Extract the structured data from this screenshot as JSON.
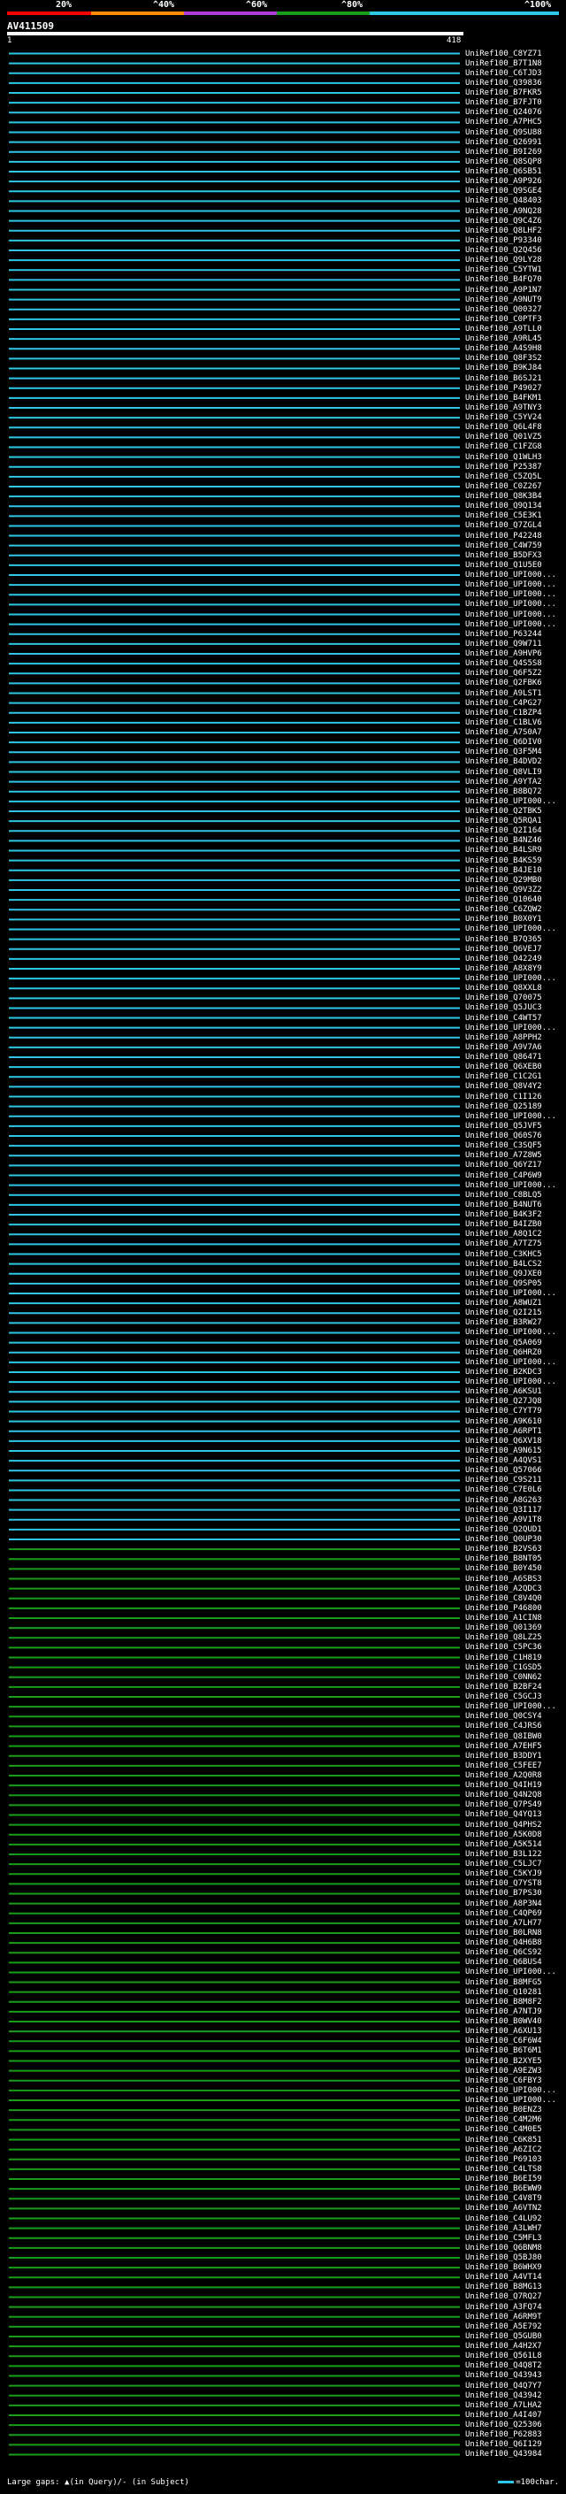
{
  "scale": {
    "labels": [
      "20%",
      "^40%",
      "^60%",
      "^80%",
      "^100%"
    ],
    "colors": [
      "#ff0000",
      "#ff8c00",
      "#b23ad6",
      "#1a9e1a",
      "#2ec8e6"
    ]
  },
  "query": {
    "title": "AV411509",
    "start": "1",
    "end": "418"
  },
  "colors": {
    "blue": "#2ec8e6",
    "green": "#1a9e1a",
    "gap": "#000000"
  },
  "hits": [
    "UniRef100_C8YZ71",
    "UniRef100_B7T1N8",
    "UniRef100_C6TJD3",
    "UniRef100_Q39836",
    "UniRef100_B7FKR5",
    "UniRef100_B7FJT0",
    "UniRef100_Q24076",
    "UniRef100_A7PHC5",
    "UniRef100_Q9SU88",
    "UniRef100_Q26991",
    "UniRef100_B9I269",
    "UniRef100_Q8SQP8",
    "UniRef100_Q6SB51",
    "UniRef100_A9P926",
    "UniRef100_Q9SGE4",
    "UniRef100_Q48403",
    "UniRef100_A9NQ28",
    "UniRef100_Q9C4Z6",
    "UniRef100_Q8LHF2",
    "UniRef100_P93340",
    "UniRef100_Q2Q456",
    "UniRef100_Q9LY28",
    "UniRef100_C5YTW1",
    "UniRef100_B4FQ70",
    "UniRef100_A9P1N7",
    "UniRef100_A9NUT9",
    "UniRef100_Q00327",
    "UniRef100_C0PTF3",
    "UniRef100_A9TLL0",
    "UniRef100_A9RL45",
    "UniRef100_A4S9H8",
    "UniRef100_Q8F3S2",
    "UniRef100_B9KJ84",
    "UniRef100_B6SJ21",
    "UniRef100_P49027",
    "UniRef100_B4FKM1",
    "UniRef100_A9TNY3",
    "UniRef100_C5YV24",
    "UniRef100_Q6L4F8",
    "UniRef100_Q01VZ5",
    "UniRef100_C1FZG8",
    "UniRef100_Q1WLH3",
    "UniRef100_P25387",
    "UniRef100_C5ZQ5L",
    "UniRef100_C0Z267",
    "UniRef100_Q8K3B4",
    "UniRef100_Q9Q134",
    "UniRef100_C5E3K1",
    "UniRef100_Q7ZGL4",
    "UniRef100_P42248",
    "UniRef100_C4W759",
    "UniRef100_B5DFX3",
    "UniRef100_Q1U5E0",
    "UniRef100_UPI000...",
    "UniRef100_UPI000...",
    "UniRef100_UPI000...",
    "UniRef100_UPI000...",
    "UniRef100_UPI000...",
    "UniRef100_UPI000...",
    "UniRef100_P63244",
    "UniRef100_Q9W711",
    "UniRef100_A9HVP6",
    "UniRef100_Q4S5S8",
    "UniRef100_Q6F5Z2",
    "UniRef100_Q2FBK6",
    "UniRef100_A9LST1",
    "UniRef100_C4PG27",
    "UniRef100_C1BZP4",
    "UniRef100_C1BLV6",
    "UniRef100_A7S0A7",
    "UniRef100_Q6DIV0",
    "UniRef100_Q3F5M4",
    "UniRef100_B4DVD2",
    "UniRef100_Q8VLI9",
    "UniRef100_A9YTA2",
    "UniRef100_B8BQ72",
    "UniRef100_UPI000...",
    "UniRef100_Q2TBK5",
    "UniRef100_Q5RQA1",
    "UniRef100_Q2I164",
    "UniRef100_B4NZ46",
    "UniRef100_B4LSR9",
    "UniRef100_B4KS59",
    "UniRef100_B4JE10",
    "UniRef100_Q29MB0",
    "UniRef100_Q9V3Z2",
    "UniRef100_Q10640",
    "UniRef100_C6ZQW2",
    "UniRef100_B0X0Y1",
    "UniRef100_UPI000...",
    "UniRef100_B7Q365",
    "UniRef100_Q6VEJ7",
    "UniRef100_O42249",
    "UniRef100_A8X8Y9",
    "UniRef100_UPI000...",
    "UniRef100_Q8XXL8",
    "UniRef100_Q70075",
    "UniRef100_Q5JUC3",
    "UniRef100_C4WT57",
    "UniRef100_UPI000...",
    "UniRef100_A8PPH2",
    "UniRef100_A9V7A6",
    "UniRef100_Q86471",
    "UniRef100_Q6XEB0",
    "UniRef100_C1C2G1",
    "UniRef100_Q8V4Y2",
    "UniRef100_C1I126",
    "UniRef100_Q25189",
    "UniRef100_UPI000...",
    "UniRef100_Q5JVF5",
    "UniRef100_Q60S76",
    "UniRef100_C3SQF5",
    "UniRef100_A7Z8W5",
    "UniRef100_Q6YZ17",
    "UniRef100_C4P6W9",
    "UniRef100_UPI000...",
    "UniRef100_C8BLQ5",
    "UniRef100_B4NUT6",
    "UniRef100_B4K3F2",
    "UniRef100_B4IZB0",
    "UniRef100_A8Q1C2",
    "UniRef100_A7TZ75",
    "UniRef100_C3KHC5",
    "UniRef100_B4LCS2",
    "UniRef100_Q9JXE0",
    "UniRef100_Q9SP05",
    "UniRef100_UPI000...",
    "UniRef100_A8WUZ1",
    "UniRef100_Q2I215",
    "UniRef100_B3RW27",
    "UniRef100_UPI000...",
    "UniRef100_Q5A069",
    "UniRef100_Q6HRZ0",
    "UniRef100_UPI000...",
    "UniRef100_B2KDC3",
    "UniRef100_UPI000...",
    "UniRef100_A6KSU1",
    "UniRef100_Q27JQ8",
    "UniRef100_C7YT79",
    "UniRef100_A9K610",
    "UniRef100_A6RPT1",
    "UniRef100_Q6XV18",
    "UniRef100_A9N615",
    "UniRef100_A4QVS1",
    "UniRef100_Q57066",
    "UniRef100_C9S211",
    "UniRef100_C7E0L6",
    "UniRef100_A8G263",
    "UniRef100_Q3I117",
    "UniRef100_A9V1T8",
    "UniRef100_Q2QUD1",
    "UniRef100_Q0UP30",
    "UniRef100_B2VS63",
    "UniRef100_B8NT05",
    "UniRef100_B0Y450",
    "UniRef100_A6SBS3",
    "UniRef100_A2QDC3",
    "UniRef100_C8V4Q0",
    "UniRef100_P46800",
    "UniRef100_A1CIN8",
    "UniRef100_Q01369",
    "UniRef100_Q8LZ25",
    "UniRef100_C5PC36",
    "UniRef100_C1H819",
    "UniRef100_C1GSD5",
    "UniRef100_C0NN62",
    "UniRef100_B2BF24",
    "UniRef100_C5GCJ3",
    "UniRef100_UPI000...",
    "UniRef100_Q0CSY4",
    "UniRef100_C4JRS6",
    "UniRef100_Q8IBW0",
    "UniRef100_A7EHF5",
    "UniRef100_B3DDY1",
    "UniRef100_C5FEE7",
    "UniRef100_A2Q0R8",
    "UniRef100_Q4IH19",
    "UniRef100_Q4N2Q8",
    "UniRef100_Q7PS49",
    "UniRef100_Q4YQ13",
    "UniRef100_Q4PHS2",
    "UniRef100_A5K0D8",
    "UniRef100_A5K514",
    "UniRef100_B3L122",
    "UniRef100_C5LJC7",
    "UniRef100_C5KYJ9",
    "UniRef100_Q7YST8",
    "UniRef100_B7PS30",
    "UniRef100_A8P3N4",
    "UniRef100_C4QP69",
    "UniRef100_A7LH77",
    "UniRef100_B0LRN8",
    "UniRef100_Q4H6B8",
    "UniRef100_Q6CS92",
    "UniRef100_Q6BUS4",
    "UniRef100_UPI000...",
    "UniRef100_B8MFG5",
    "UniRef100_Q10281",
    "UniRef100_B8M8F2",
    "UniRef100_A7NTJ9",
    "UniRef100_B0WV40",
    "UniRef100_A6XU13",
    "UniRef100_C6F6W4",
    "UniRef100_B6T6M1",
    "UniRef100_B2XYE5",
    "UniRef100_A9EZW3",
    "UniRef100_C6FBY3",
    "UniRef100_UPI000...",
    "UniRef100_UPI000...",
    "UniRef100_B0ENZ3",
    "UniRef100_C4M2M6",
    "UniRef100_C4M0E5",
    "UniRef100_C6K851",
    "UniRef100_A6ZIC2",
    "UniRef100_P69103",
    "UniRef100_C4LTS8",
    "UniRef100_B6EI59",
    "UniRef100_B6EWW9",
    "UniRef100_C4V8T9",
    "UniRef100_A6VTN2",
    "UniRef100_C4LU92",
    "UniRef100_A3LWH7",
    "UniRef100_C5MFL3",
    "UniRef100_Q6BNM8",
    "UniRef100_Q5BJ80",
    "UniRef100_B6WHX9",
    "UniRef100_A4VT14",
    "UniRef100_B8MG13",
    "UniRef100_Q7RQ27",
    "UniRef100_A3FQ74",
    "UniRef100_A6RM9T",
    "UniRef100_A5E792",
    "UniRef100_Q5GUB0",
    "UniRef100_A4H2X7",
    "UniRef100_Q561L8",
    "UniRef100_Q4Q8T2",
    "UniRef100_Q43943",
    "UniRef100_Q4Q7Y7",
    "UniRef100_Q43942",
    "UniRef100_A7LHA2",
    "UniRef100_A4I407",
    "UniRef100_Q25306",
    "UniRef100_P62883",
    "UniRef100_Q6I129",
    "UniRef100_Q43984"
  ],
  "legend": {
    "text": "Large gaps: ▲(in Query)/- (in Subject)",
    "scale_text": "=100char."
  }
}
